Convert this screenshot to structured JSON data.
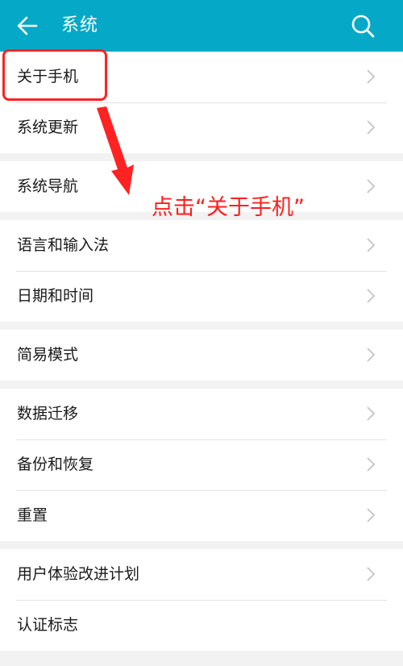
{
  "header": {
    "back_icon": "arrow-left-icon",
    "title": "系统",
    "search_icon": "search-icon",
    "bg_color": "#05a9c7"
  },
  "groups": [
    {
      "items": [
        {
          "label": "关于手机"
        },
        {
          "label": "系统更新"
        }
      ]
    },
    {
      "items": [
        {
          "label": "系统导航"
        }
      ]
    },
    {
      "items": [
        {
          "label": "语言和输入法"
        },
        {
          "label": "日期和时间"
        }
      ]
    },
    {
      "items": [
        {
          "label": "简易模式"
        }
      ]
    },
    {
      "items": [
        {
          "label": "数据迁移"
        },
        {
          "label": "备份和恢复"
        },
        {
          "label": "重置"
        }
      ]
    },
    {
      "items": [
        {
          "label": "用户体验改进计划"
        },
        {
          "label": "认证标志"
        }
      ]
    }
  ],
  "annotation": {
    "text": "点击“关于手机”",
    "color": "#ff1e1e"
  }
}
